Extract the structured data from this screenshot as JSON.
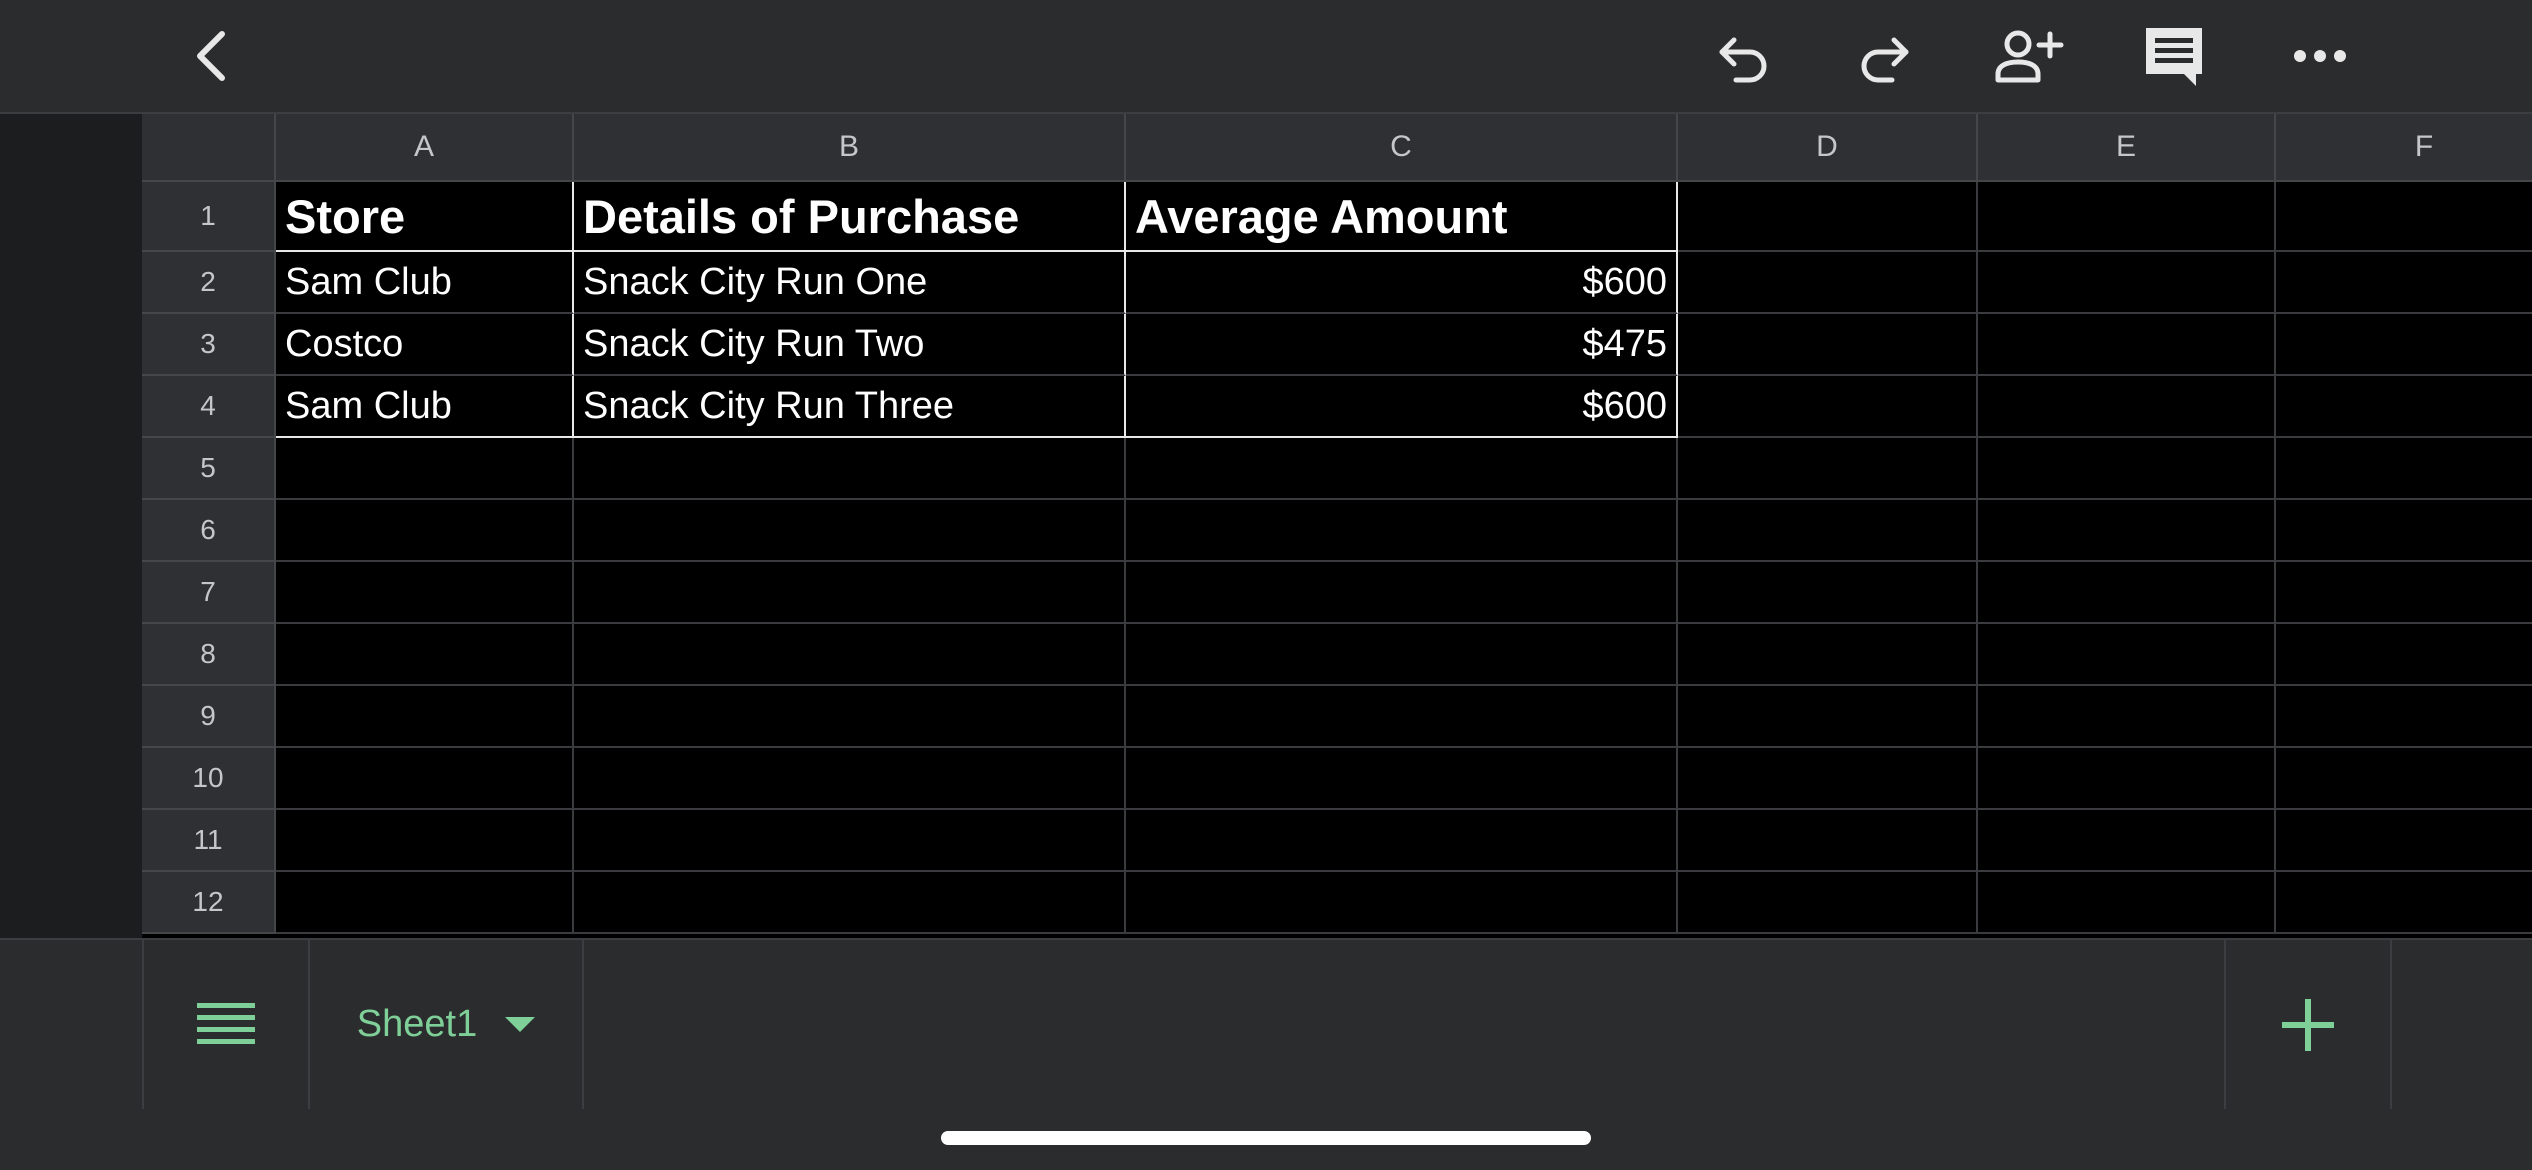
{
  "toolbar": {
    "icons": [
      "back-icon",
      "undo-icon",
      "redo-icon",
      "add-person-icon",
      "comment-icon",
      "more-icon"
    ]
  },
  "sheet": {
    "columns": [
      "A",
      "B",
      "C",
      "D",
      "E",
      "F"
    ],
    "rows": [
      "1",
      "2",
      "3",
      "4",
      "5",
      "6",
      "7",
      "8",
      "9",
      "10",
      "11",
      "12"
    ],
    "headers": [
      "Store",
      "Details of Purchase",
      "Average Amount"
    ],
    "data": [
      [
        "Sam Club",
        "Snack City Run One",
        "$600"
      ],
      [
        "Costco",
        "Snack City Run Two",
        "$475"
      ],
      [
        "Sam Club",
        "Snack City Run Three",
        "$600"
      ]
    ]
  },
  "sheetbar": {
    "tab_label": "Sheet1",
    "tab_color": "#7fcf98",
    "icons": [
      "sheet-list-icon",
      "dropdown-arrow-icon",
      "add-sheet-icon"
    ]
  }
}
